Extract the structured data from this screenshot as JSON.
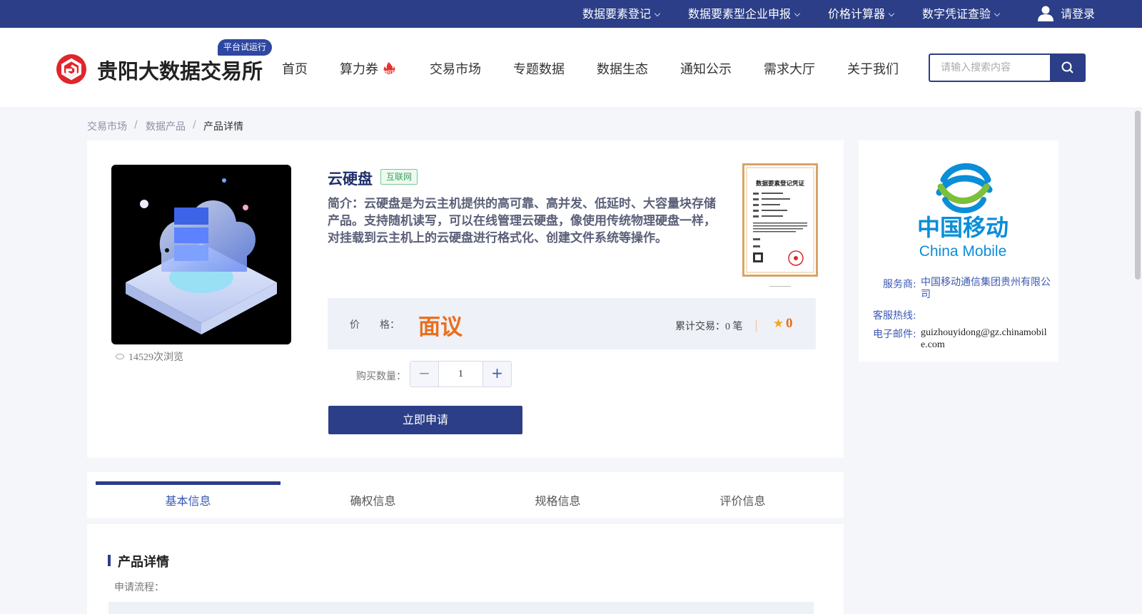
{
  "topbar": {
    "items": [
      "数据要素登记",
      "数据要素型企业申报",
      "价格计算器",
      "数字凭证查验"
    ],
    "login": "请登录"
  },
  "header": {
    "brand": "贵阳大数据交易所",
    "beta_badge": "平台试运行",
    "nav": [
      "首页",
      "算力券",
      "交易市场",
      "专题数据",
      "数据生态",
      "通知公示",
      "需求大厅",
      "关于我们"
    ],
    "hot_badge": "HOT",
    "search_placeholder": "请输入搜索内容"
  },
  "breadcrumb": [
    "交易市场",
    "数据产品",
    "产品详情"
  ],
  "product": {
    "title": "云硬盘",
    "tag": "互联网",
    "intro": "简介：云硬盘是为云主机提供的高可靠、高并发、低延时、大容量块存储产品。支持随机读写，可以在线管理云硬盘，像使用传统物理硬盘一样，对挂载到云主机上的云硬盘进行格式化、创建文件系统等操作。",
    "views": "14529次浏览",
    "certificate_title": "数据要素登记凭证",
    "price_label": "价　　格：",
    "price_value": "面议",
    "deal_text": "累计交易：0 笔",
    "rating": "0",
    "quantity_label": "购买数量：",
    "quantity": "1",
    "apply_button": "立即申请"
  },
  "provider": {
    "logo_cn": "中国移动",
    "logo_en": "China Mobile",
    "service_label": "服务商:",
    "service_value": "中国移动通信集团贵州有限公司",
    "hotline_label": "客服热线:",
    "email_label": "电子邮件:",
    "email_value": "guizhouyidong@gz.chinamobile.com"
  },
  "tabs": [
    "基本信息",
    "确权信息",
    "规格信息",
    "评价信息"
  ],
  "detail": {
    "title": "产品详情",
    "flow_label": "申请流程："
  },
  "colors": {
    "primary": "#2b3e87",
    "price": "#ec6e1b",
    "tag_green": "#3aa35c"
  }
}
